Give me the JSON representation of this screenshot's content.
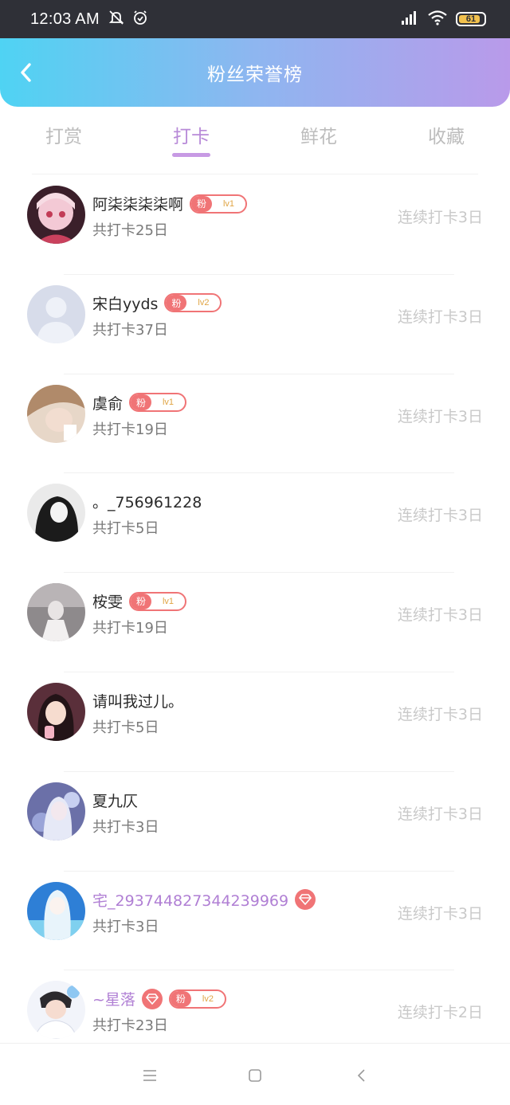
{
  "status_bar": {
    "time": "12:03 AM",
    "battery": "61",
    "icons": [
      "mute-icon",
      "alarm-icon",
      "signal-icon",
      "wifi-icon",
      "battery-icon"
    ]
  },
  "header": {
    "title": "粉丝荣誉榜",
    "gradient": [
      "#4fd3f3",
      "#b99aea"
    ]
  },
  "tabs": [
    {
      "label": "打赏",
      "active": false
    },
    {
      "label": "打卡",
      "active": true
    },
    {
      "label": "鲜花",
      "active": false
    },
    {
      "label": "收藏",
      "active": false
    }
  ],
  "rows": [
    {
      "name": "阿柒柒柒柒啊",
      "total": "共打卡25日",
      "streak": "连续打卡3日",
      "fan_badge": {
        "left": "粉",
        "right": "lv1"
      },
      "gem": false,
      "vip": false
    },
    {
      "name": "宋白yyds",
      "total": "共打卡37日",
      "streak": "连续打卡3日",
      "fan_badge": {
        "left": "粉",
        "right": "lv2"
      },
      "gem": false,
      "vip": false
    },
    {
      "name": "虞俞",
      "total": "共打卡19日",
      "streak": "连续打卡3日",
      "fan_badge": {
        "left": "粉",
        "right": "lv1"
      },
      "gem": false,
      "vip": false
    },
    {
      "name": "。_756961228",
      "total": "共打卡5日",
      "streak": "连续打卡3日",
      "fan_badge": null,
      "gem": false,
      "vip": false
    },
    {
      "name": "桉雯",
      "total": "共打卡19日",
      "streak": "连续打卡3日",
      "fan_badge": {
        "left": "粉",
        "right": "lv1"
      },
      "gem": false,
      "vip": false
    },
    {
      "name": "请叫我过儿。",
      "total": "共打卡5日",
      "streak": "连续打卡3日",
      "fan_badge": null,
      "gem": false,
      "vip": false
    },
    {
      "name": "夏九仄",
      "total": "共打卡3日",
      "streak": "连续打卡3日",
      "fan_badge": null,
      "gem": false,
      "vip": false
    },
    {
      "name": "宅_293744827344239969",
      "total": "共打卡3日",
      "streak": "连续打卡3日",
      "fan_badge": null,
      "gem": true,
      "vip": true
    },
    {
      "name": "~星落",
      "total": "共打卡23日",
      "streak": "连续打卡2日",
      "fan_badge": {
        "left": "粉",
        "right": "lv2"
      },
      "gem": true,
      "vip": true
    }
  ],
  "nav_bar": {
    "icons": [
      "menu-icon",
      "home-icon",
      "back-icon"
    ]
  }
}
